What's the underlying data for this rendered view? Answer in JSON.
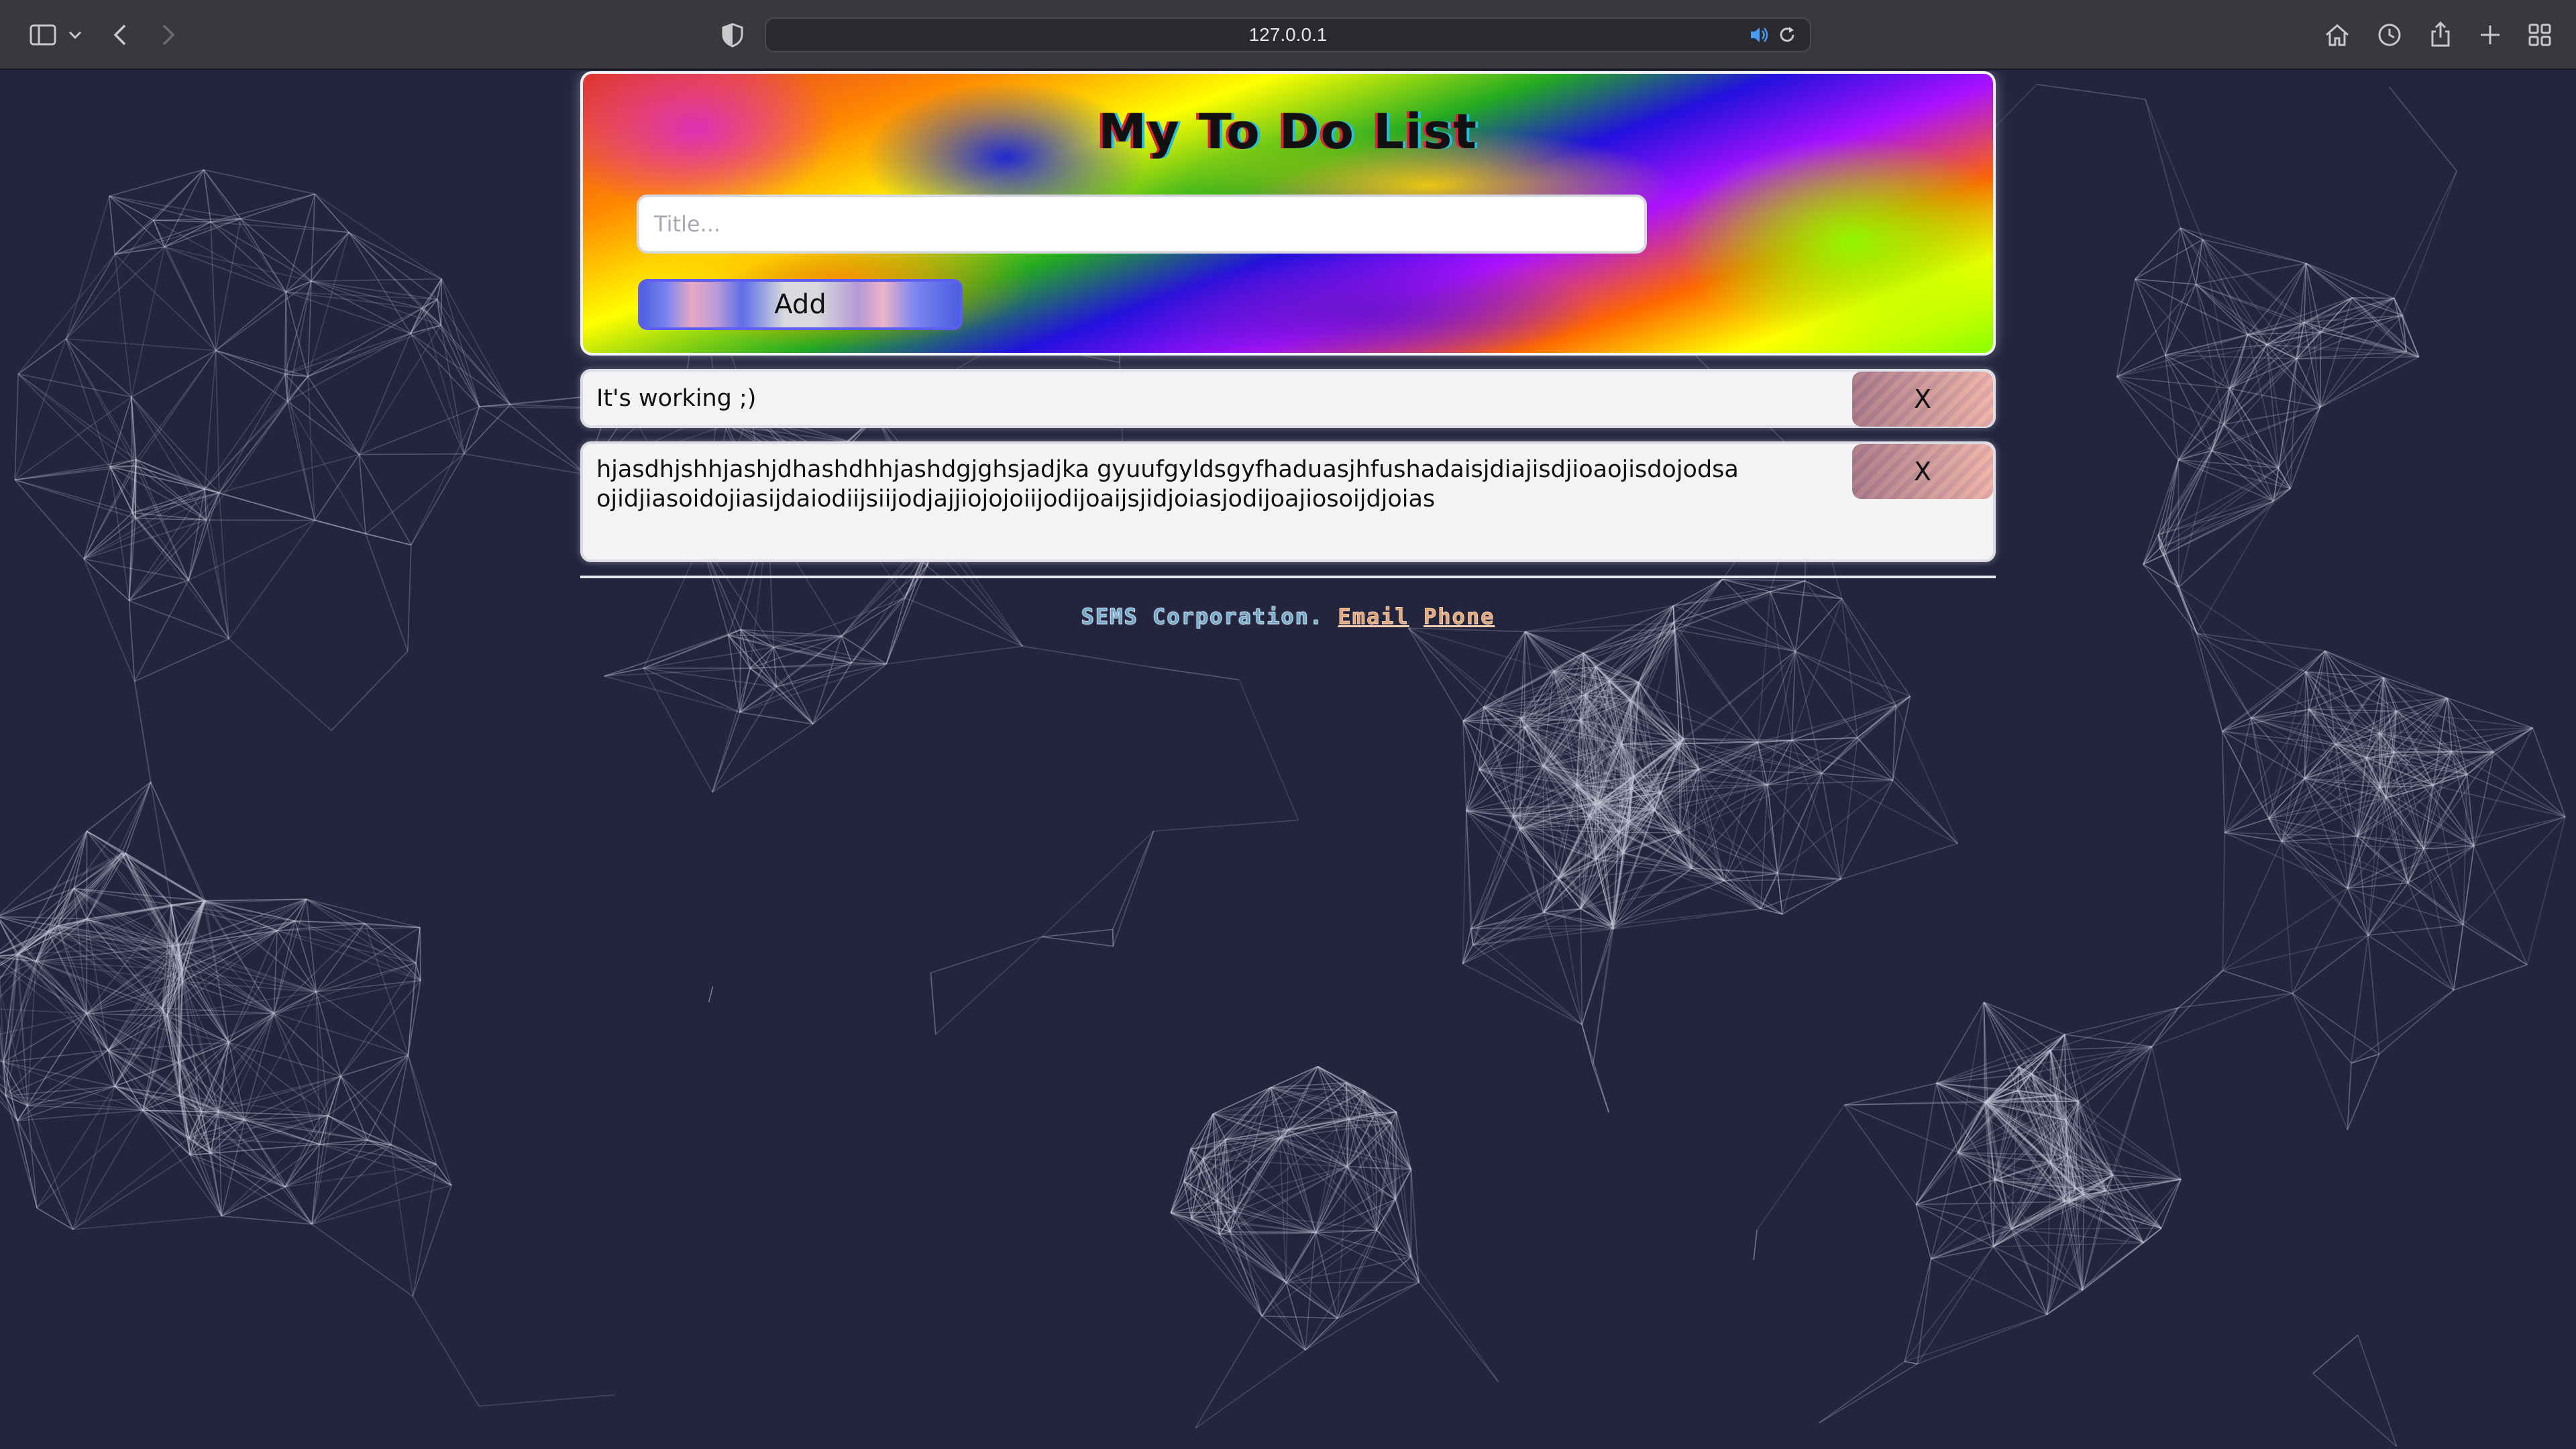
{
  "browser": {
    "url": "127.0.0.1"
  },
  "header": {
    "title": "My To Do List",
    "input_placeholder": "Title...",
    "input_value": "",
    "add_label": "Add"
  },
  "todos": [
    {
      "text": "It's working ;)",
      "delete_label": "X"
    },
    {
      "text": "hjasdhjshhjashjdhashdhhjashdgjghsjadjka gyuufgyldsgyfhaduasjhfushadaisjdiajisdjioaojisdojodsaojidjiasoidojiasijdaiodiijsiijodjajjiojojoiijodijoaijsjidjoiasjodijoajiosoijdjoias",
      "delete_label": "X"
    }
  ],
  "footer": {
    "corp": "SEMS Corporation.",
    "email": "Email",
    "phone": "Phone"
  },
  "colors": {
    "page_background": "#23253f",
    "chrome_background": "#38383d",
    "add_button_border": "#5e5ef0",
    "footer_corp": "#6fa6c8",
    "footer_link": "#e0a57a"
  }
}
